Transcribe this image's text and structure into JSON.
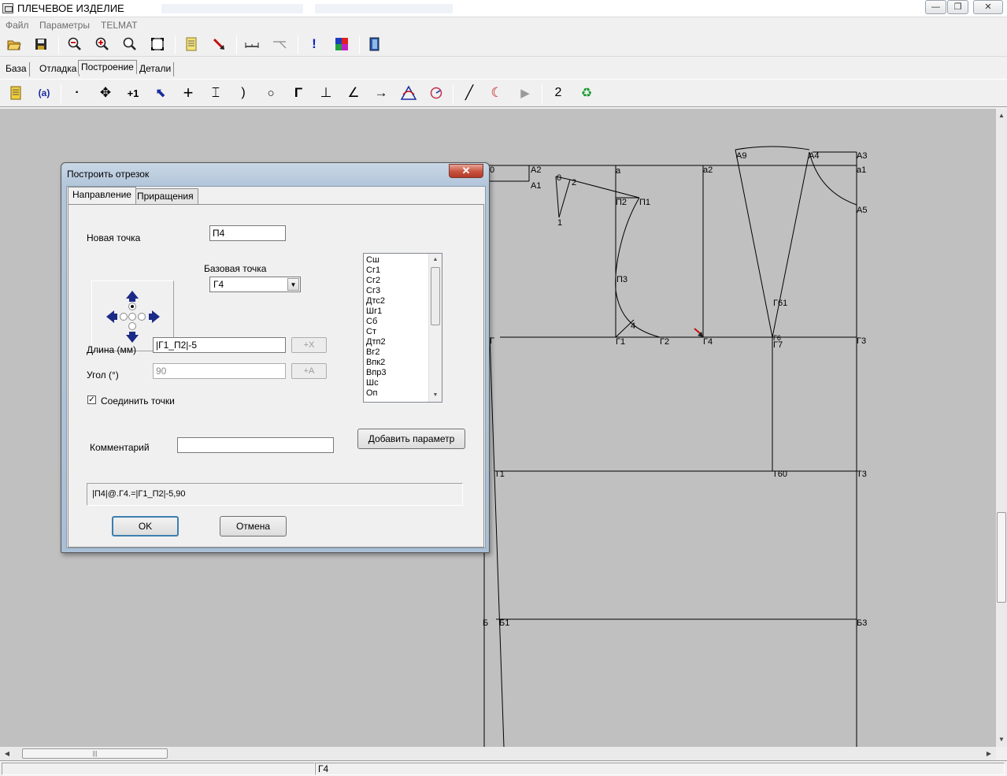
{
  "window": {
    "title": "ПЛЕЧЕВОЕ ИЗДЕЛИЕ",
    "controls": {
      "minimize": "—",
      "restore": "❐",
      "close": "✕"
    }
  },
  "menu": [
    "Файл",
    "Параметры",
    "TELMAT"
  ],
  "toolbar_main": [
    {
      "name": "open-icon",
      "glyph": "📂"
    },
    {
      "name": "save-icon",
      "glyph": "💾"
    },
    {
      "name": "zoom-out-icon",
      "glyph": "🔍"
    },
    {
      "name": "zoom-in-icon",
      "glyph": "🔍"
    },
    {
      "name": "zoom-icon",
      "glyph": "🔍"
    },
    {
      "name": "fit-window-icon",
      "glyph": "⛶"
    },
    {
      "name": "document-icon",
      "glyph": "📄"
    },
    {
      "name": "pointer-red-icon",
      "glyph": "➘"
    },
    {
      "name": "measure-icon",
      "glyph": "⊢"
    },
    {
      "name": "measure-angle-icon",
      "glyph": "⊾"
    },
    {
      "name": "exclamation-icon",
      "glyph": "!"
    },
    {
      "name": "palette-icon",
      "glyph": "▦"
    },
    {
      "name": "exit-icon",
      "glyph": "⍈"
    }
  ],
  "tabs": [
    "База",
    "Отладка",
    "Построение",
    "Детали"
  ],
  "toolbar_build": [
    {
      "name": "notes-icon",
      "glyph": "📒"
    },
    {
      "name": "variable-icon",
      "glyph": "(a)"
    },
    {
      "name": "point-icon",
      "glyph": "·"
    },
    {
      "name": "move-icon",
      "glyph": "✥"
    },
    {
      "name": "plus-one-icon",
      "glyph": "+1"
    },
    {
      "name": "select-icon",
      "glyph": "⬉"
    },
    {
      "name": "cross-icon",
      "glyph": "+"
    },
    {
      "name": "bisect-icon",
      "glyph": "⌶"
    },
    {
      "name": "arc-point-icon",
      "glyph": ")"
    },
    {
      "name": "circle-point-icon",
      "glyph": "○"
    },
    {
      "name": "corner-icon",
      "glyph": "Γ"
    },
    {
      "name": "perpendicular-icon",
      "glyph": "⊥"
    },
    {
      "name": "angle-icon",
      "glyph": "∠"
    },
    {
      "name": "direction-icon",
      "glyph": "→"
    },
    {
      "name": "triangle-curve-icon",
      "glyph": "△"
    },
    {
      "name": "circle-curve-icon",
      "glyph": "◔"
    },
    {
      "name": "line-icon",
      "glyph": "╱"
    },
    {
      "name": "curve-icon",
      "glyph": "☾"
    },
    {
      "name": "play-icon",
      "glyph": "▶"
    },
    {
      "name": "number-two-icon",
      "glyph": "2"
    },
    {
      "name": "recycle-icon",
      "glyph": "♻"
    }
  ],
  "dialog": {
    "title": "Построить отрезок",
    "close_label": "✕",
    "tabs": [
      "Направление",
      "Приращения"
    ],
    "new_point_label": "Новая точка",
    "new_point_value": "П4",
    "base_point_label": "Базовая точка",
    "base_point_value": "Г4",
    "length_label": "Длина (мм)",
    "length_value": "|Г1_П2|-5",
    "length_btn": "+X",
    "angle_label": "Угол (°)",
    "angle_value": "90",
    "angle_btn": "+A",
    "connect_label": "Соединить точки",
    "connect_checked": true,
    "comment_label": "Комментарий",
    "comment_value": "",
    "add_param_btn": "Добавить параметр",
    "formula": "|П4|@.Г4.=|Г1_П2|-5,90",
    "ok_btn": "OK",
    "cancel_btn": "Отмена",
    "params": [
      "Сш",
      "Сг1",
      "Сг2",
      "Сг3",
      "Дтс2",
      "Шг1",
      "Сб",
      "Ст",
      "Дтп2",
      "Вг2",
      "Впк2",
      "Впр3",
      "Шс",
      "Оп"
    ]
  },
  "canvas_labels": [
    "0",
    "А2",
    "А1",
    "0",
    "2",
    "1",
    "а",
    "П2",
    "П1",
    "П3",
    "4",
    "Г1",
    "Г2",
    "Г4",
    "а2",
    "А9",
    "А4",
    "А3",
    "а1",
    "А5",
    "Г61",
    "Г6",
    "Г7",
    "Г3",
    "Т1",
    "Т60",
    "Т3",
    "Б",
    "Б1",
    "Б3",
    "Г"
  ],
  "status": {
    "pane1": "",
    "pane2": "Г4"
  },
  "colors": {
    "canvas": "#c0c0c0",
    "dialog_frame": "#b3c6da",
    "close_red": "#c8523e",
    "arrow_blue": "#1b2a87"
  }
}
